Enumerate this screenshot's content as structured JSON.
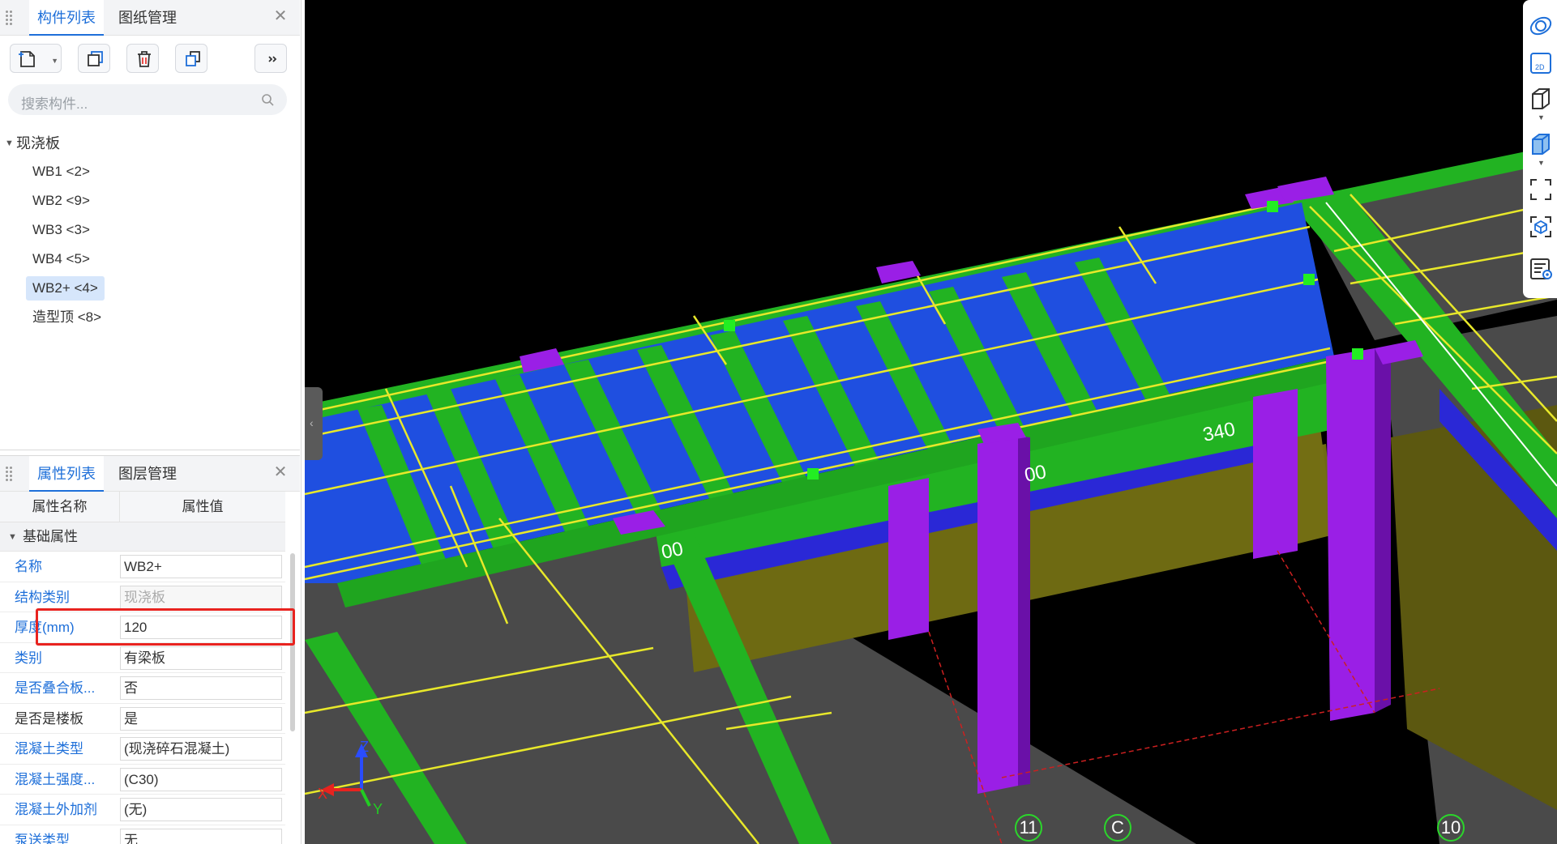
{
  "panels": {
    "top": {
      "tabs": [
        {
          "label": "构件列表",
          "active": true
        },
        {
          "label": "图纸管理",
          "active": false
        }
      ],
      "toolbar": {
        "buttons": [
          "new-component",
          "copy-component",
          "delete-component",
          "duplicate-layer",
          "more"
        ]
      },
      "search": {
        "placeholder": "搜索构件..."
      },
      "tree": {
        "root_label": "现浇板",
        "items": [
          {
            "label": "WB1  <2>",
            "selected": false
          },
          {
            "label": "WB2  <9>",
            "selected": false
          },
          {
            "label": "WB3  <3>",
            "selected": false
          },
          {
            "label": "WB4  <5>",
            "selected": false
          },
          {
            "label": "WB2+  <4>",
            "selected": true
          },
          {
            "label": "造型顶  <8>",
            "selected": false
          }
        ]
      }
    },
    "bottom": {
      "tabs": [
        {
          "label": "属性列表",
          "active": true
        },
        {
          "label": "图层管理",
          "active": false
        }
      ],
      "grid": {
        "col_name": "属性名称",
        "col_value": "属性值",
        "group": "基础属性",
        "rows": [
          {
            "name": "名称",
            "value": "WB2+"
          },
          {
            "name": "结构类别",
            "value": "现浇板"
          },
          {
            "name": "厚度(mm)",
            "value": "120"
          },
          {
            "name": "类别",
            "value": "有梁板"
          },
          {
            "name": "是否叠合板...",
            "value": "否"
          },
          {
            "name": "是否是楼板",
            "value": "是"
          },
          {
            "name": "混凝土类型",
            "value": "(现浇碎石混凝土)"
          },
          {
            "name": "混凝土强度...",
            "value": "(C30)"
          },
          {
            "name": "混凝土外加剂",
            "value": "(无)"
          },
          {
            "name": "泵送类型",
            "value": "无"
          }
        ]
      }
    }
  },
  "viewport": {
    "dimension_labels": [
      "340",
      "00",
      "00"
    ],
    "axis_labels": {
      "x": "X",
      "y": "Y",
      "z": "Z"
    },
    "grid_bubbles": [
      "11",
      "C",
      "10"
    ]
  },
  "view_tools": [
    "orbit-icon",
    "2d-view-icon",
    "3d-box-icon",
    "solid-box-icon",
    "fullscreen-icon",
    "view-cube-icon",
    "layer-view-icon"
  ],
  "colors": {
    "accent": "#1e6fd9",
    "slab_blue": "#1f4fe0",
    "beam_green": "#22b322",
    "column_purple": "#9a1fe6",
    "rebar_yellow": "#e8e82a",
    "highlight_red": "#e8231f"
  }
}
